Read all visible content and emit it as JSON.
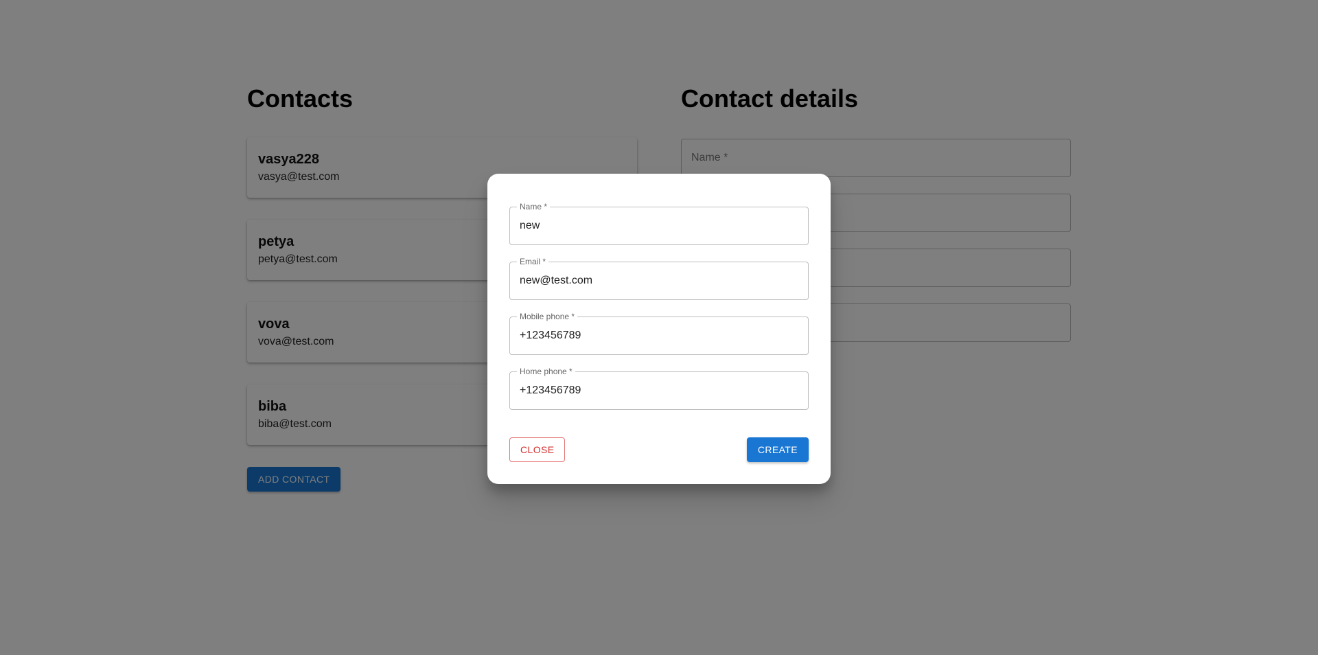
{
  "contacts": {
    "title": "Contacts",
    "items": [
      {
        "name": "vasya228",
        "email": "vasya@test.com"
      },
      {
        "name": "petya",
        "email": "petya@test.com"
      },
      {
        "name": "vova",
        "email": "vova@test.com"
      },
      {
        "name": "biba",
        "email": "biba@test.com"
      }
    ],
    "add_button": "ADD CONTACT"
  },
  "details": {
    "title": "Contact details",
    "fields": [
      {
        "placeholder": "Name *"
      },
      {
        "placeholder": ""
      },
      {
        "placeholder": ""
      },
      {
        "placeholder": ""
      }
    ]
  },
  "dialog": {
    "fields": [
      {
        "label": "Name *",
        "value": "new"
      },
      {
        "label": "Email *",
        "value": "new@test.com"
      },
      {
        "label": "Mobile phone *",
        "value": "+123456789"
      },
      {
        "label": "Home phone *",
        "value": "+123456789"
      }
    ],
    "close_label": "CLOSE",
    "create_label": "CREATE"
  },
  "colors": {
    "primary": "#1976d2",
    "error": "#d32f2f",
    "backdrop": "rgba(0,0,0,0.5)"
  }
}
